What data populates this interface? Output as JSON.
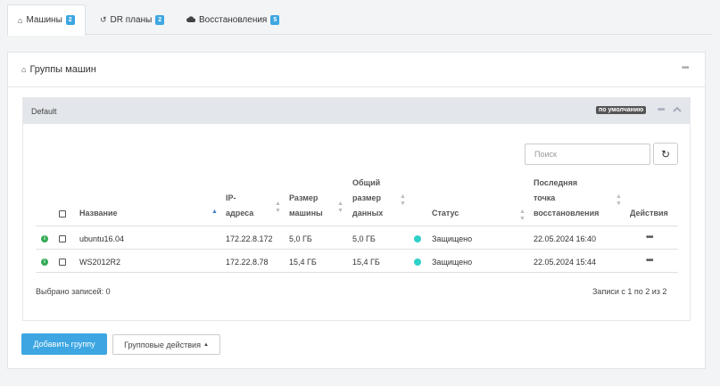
{
  "tabs": [
    {
      "icon": "home-icon",
      "label": "Машины",
      "badge": "2",
      "active": true
    },
    {
      "icon": "history-icon",
      "label": "DR планы",
      "badge": "2",
      "active": false
    },
    {
      "icon": "cloud-icon",
      "label": "Восстановления",
      "badge": "5",
      "active": false
    }
  ],
  "panel": {
    "title": "Группы машин"
  },
  "group": {
    "name": "Default",
    "badge": "по умолчанию"
  },
  "search": {
    "placeholder": "Поиск"
  },
  "table": {
    "headers": {
      "name": "Название",
      "ip": [
        "IP-",
        "адреса"
      ],
      "size": [
        "Размер",
        "машины"
      ],
      "total": [
        "Общий",
        "размер",
        "данных"
      ],
      "status": "Статус",
      "restore": [
        "Последняя",
        "точка",
        "восстановления"
      ],
      "actions": "Действия"
    },
    "rows": [
      {
        "name": "ubuntu16.04",
        "ip": "172.22.8.172",
        "size": "5,0 ГБ",
        "total": "5,0 ГБ",
        "status": "Защищено",
        "restore": "22.05.2024 16:40"
      },
      {
        "name": "WS2012R2",
        "ip": "172.22.8.78",
        "size": "15,4 ГБ",
        "total": "15,4 ГБ",
        "status": "Защищено",
        "restore": "22.05.2024 15:44"
      }
    ]
  },
  "footer": {
    "selected": "Выбрано записей: 0",
    "records": "Записи с 1 по 2 из 2"
  },
  "buttons": {
    "add_group": "Добавить группу",
    "group_actions": "Групповые действия"
  },
  "colors": {
    "accent": "#3da6e2",
    "status_ok": "#2ed1c7",
    "info": "#33aa55"
  }
}
